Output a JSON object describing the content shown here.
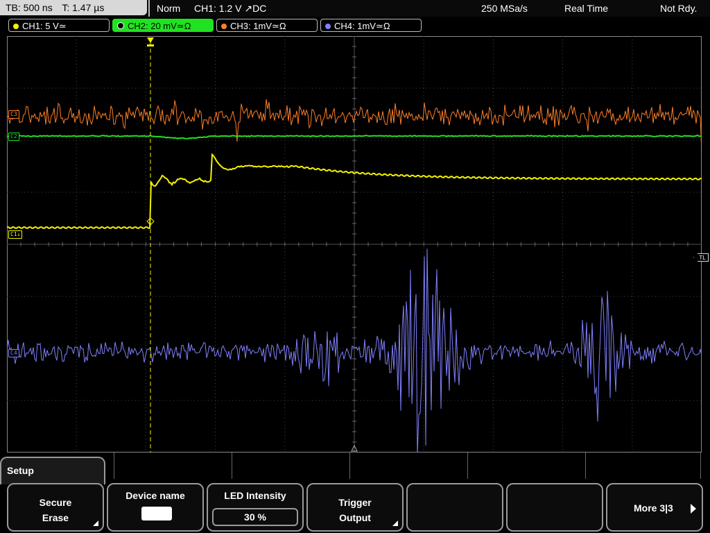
{
  "topbar": {
    "timebase": "TB: 500 ns",
    "trigger_time": "T: 1.47 µs",
    "trigger_mode": "Norm",
    "trigger_info": "CH1: 1.2 V ↗DC",
    "sample_rate": "250 MSa/s",
    "acq_mode": "Real Time",
    "status": "Not Rdy."
  },
  "channels": [
    {
      "label": "CH1: 5 V≃",
      "color": "#f3f300",
      "active": false
    },
    {
      "label": "CH2: 20 mV≃Ω",
      "color": "#21e221",
      "active": true
    },
    {
      "label": "CH3: 1mV≃Ω",
      "color": "#ff7f27",
      "active": false
    },
    {
      "label": "CH4: 1mV≃Ω",
      "color": "#8080ff",
      "active": false
    }
  ],
  "markers": {
    "ch1": "C1↓",
    "ch2": "C2",
    "ch3": "C3",
    "ch4": "C4",
    "trigger_level": "TL"
  },
  "menu": {
    "title": "Setup",
    "softkeys": [
      {
        "line1": "Secure",
        "line2": "Erase"
      },
      {
        "line1": "Device name",
        "line2": ""
      },
      {
        "line1": "LED Intensity",
        "value": "30 %"
      },
      {
        "line1": "Trigger",
        "line2": "Output"
      },
      {
        "line1": "",
        "line2": ""
      },
      {
        "line1": "",
        "line2": ""
      },
      {
        "line1": "More 3|3",
        "line2": ""
      }
    ]
  },
  "icons": [
    "keyboard-icon",
    "submenu-corner-icon",
    "next-page-arrow-icon",
    "trigger-position-icon"
  ]
}
